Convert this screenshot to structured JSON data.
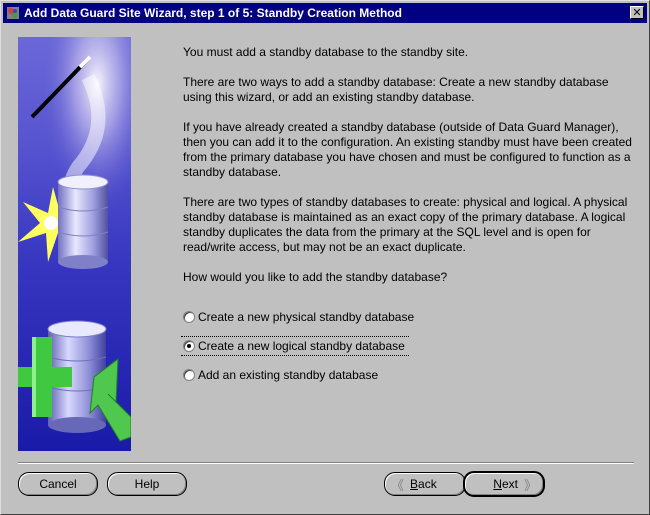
{
  "window": {
    "title": "Add Data Guard Site Wizard, step 1 of 5: Standby Creation Method",
    "close_glyph": "✕"
  },
  "content": {
    "paragraphs": [
      "You must add a standby database to the standby site.",
      "There are two ways to add a standby database: Create a new standby database using this wizard, or add an existing standby database.",
      "If you have already created a standby database (outside of Data Guard Manager), then you can add it to the configuration. An existing standby must have been created from the primary database you have chosen and must be configured to function as a standby database.",
      "There are two types of standby databases to create: physical and logical. A physical standby database is maintained as an exact copy of the primary database. A logical standby duplicates the data from the primary at the SQL level and is open for read/write access, but may not be an exact duplicate.",
      "How would you like to add the standby database?"
    ]
  },
  "options": [
    {
      "label": "Create a new physical standby database",
      "checked": false
    },
    {
      "label": "Create a new logical standby database",
      "checked": true
    },
    {
      "label": "Add an existing standby database",
      "checked": false
    }
  ],
  "buttons": {
    "cancel": "Cancel",
    "help": "Help",
    "back": "Back",
    "next": "Next",
    "back_arrow": "《",
    "next_arrow": "》"
  },
  "image": {
    "icons": [
      "magic-wand-icon",
      "database-icon",
      "starburst-icon",
      "plus-icon",
      "arrow-icon"
    ],
    "colors": {
      "top": "#e0d8f0",
      "mid": "#4040c0",
      "bottom": "#1010a0",
      "plus": "#50d050",
      "star": "#ffff40"
    }
  }
}
